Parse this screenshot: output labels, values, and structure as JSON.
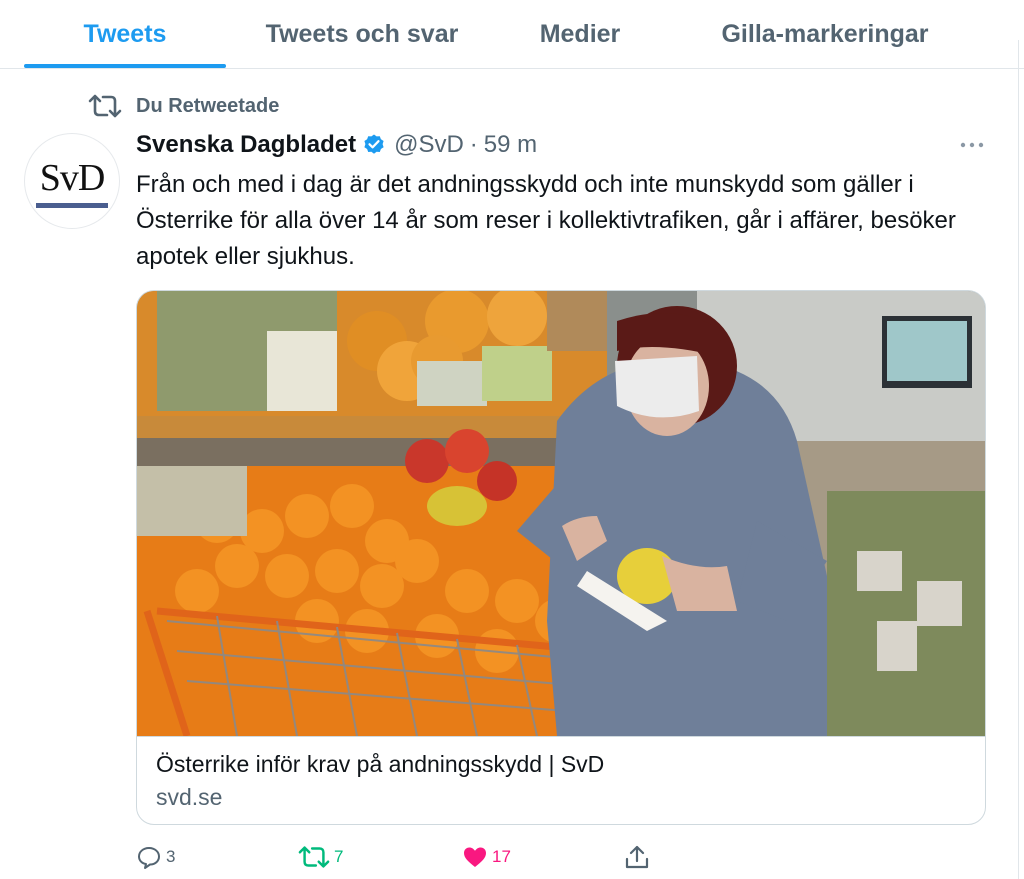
{
  "tabs": [
    {
      "label": "Tweets",
      "active": true
    },
    {
      "label": "Tweets och svar",
      "active": false
    },
    {
      "label": "Medier",
      "active": false
    },
    {
      "label": "Gilla-markeringar",
      "active": false
    }
  ],
  "retweet_context": {
    "label": "Du Retweetade",
    "icon": "retweet-icon"
  },
  "tweet": {
    "author_name": "Svenska Dagbladet",
    "verified": true,
    "handle": "@SvD",
    "separator": "·",
    "time": "59 m",
    "avatar_text": "SvD",
    "text": "Från och med i dag är det andningsskydd och inte munskydd som gäller i Österrike för alla över 14 år som reser i kollektivtrafiken, går i affärer, besöker apotek eller sjukhus.",
    "card": {
      "image_description_icon": "photo",
      "title": "Österrike inför krav på andningsskydd | SvD",
      "domain": "svd.se"
    },
    "actions": {
      "reply_count": "3",
      "retweet_count": "7",
      "like_count": "17"
    }
  },
  "colors": {
    "accent": "#1d9bf0",
    "secondary_text": "#536471",
    "retweet_green": "#00ba7c",
    "like_pink": "#f91880"
  }
}
